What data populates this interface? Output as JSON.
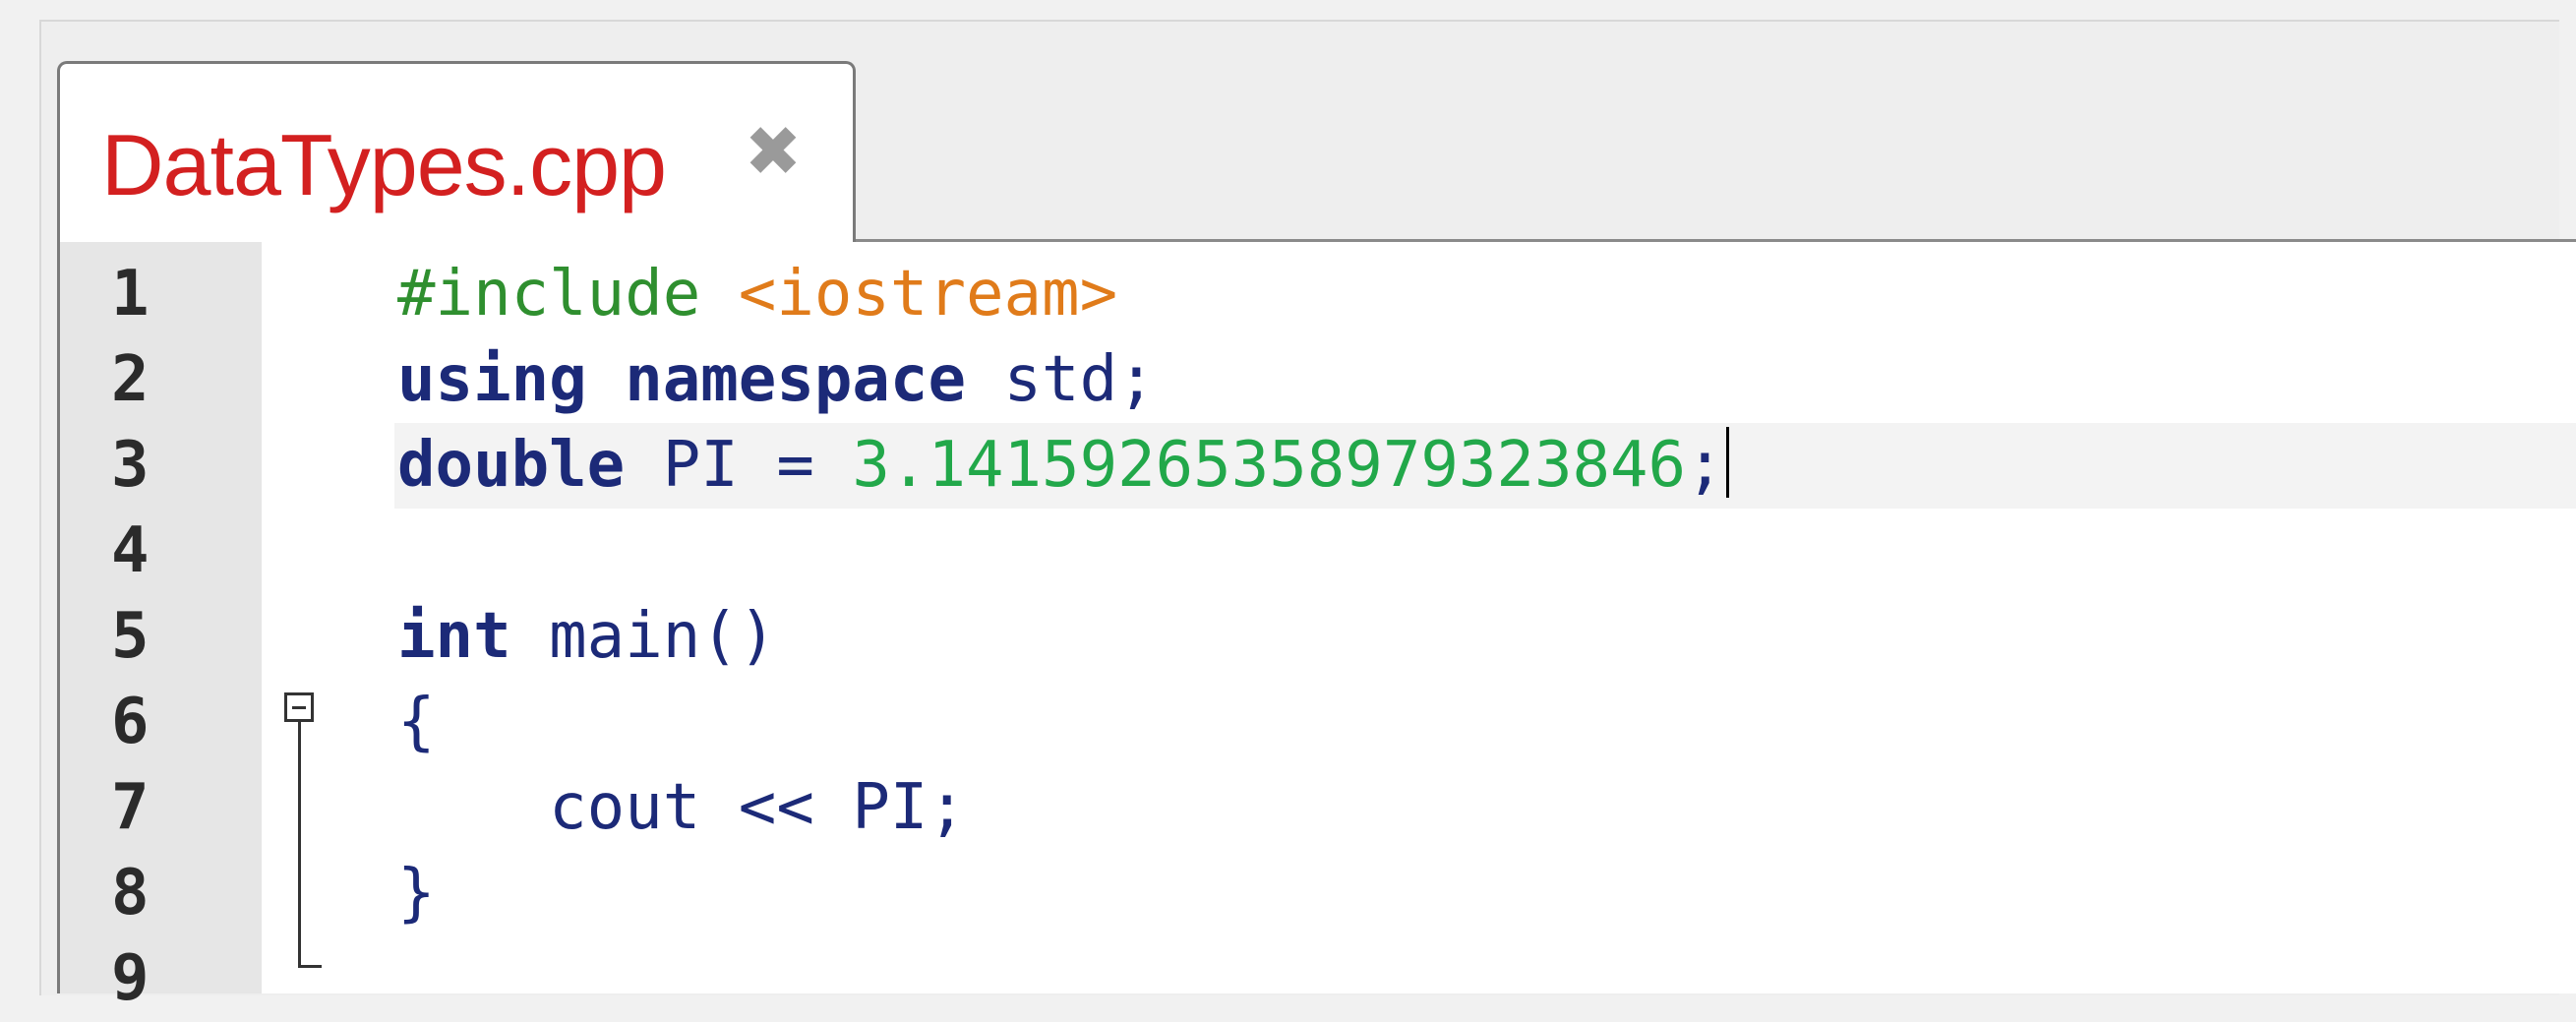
{
  "tab": {
    "title": "DataTypes.cpp",
    "close_glyph": "✖"
  },
  "editor": {
    "line_numbers": [
      "1",
      "2",
      "3",
      "4",
      "5",
      "6",
      "7",
      "8",
      "9"
    ],
    "lines": [
      {
        "n": "1",
        "tokens": [
          {
            "t": "#include",
            "c": "pp"
          },
          {
            "t": " ",
            "c": ""
          },
          {
            "t": "<iostream>",
            "c": "inc"
          }
        ]
      },
      {
        "n": "2",
        "tokens": [
          {
            "t": "using",
            "c": "kw"
          },
          {
            "t": " ",
            "c": ""
          },
          {
            "t": "namespace",
            "c": "kw"
          },
          {
            "t": " std;",
            "c": "id"
          }
        ]
      },
      {
        "n": "3",
        "tokens": [
          {
            "t": "double",
            "c": "kw"
          },
          {
            "t": " PI = ",
            "c": "id"
          },
          {
            "t": "3.14159265358979323846",
            "c": "num"
          },
          {
            "t": ";",
            "c": "id"
          }
        ]
      },
      {
        "n": "4",
        "tokens": []
      },
      {
        "n": "5",
        "tokens": [
          {
            "t": "int",
            "c": "kw"
          },
          {
            "t": " main()",
            "c": "id"
          }
        ]
      },
      {
        "n": "6",
        "tokens": [
          {
            "t": "{",
            "c": "id"
          }
        ]
      },
      {
        "n": "7",
        "tokens": [
          {
            "t": "    cout << PI;",
            "c": "id"
          }
        ]
      },
      {
        "n": "8",
        "tokens": [
          {
            "t": "}",
            "c": "id"
          }
        ]
      },
      {
        "n": "9",
        "tokens": []
      }
    ],
    "cursor_line": "3",
    "colors": {
      "keyword": "#1c2a78",
      "preprocessor": "#2f8f2f",
      "include": "#e07b1a",
      "number": "#22a84a",
      "tab_title": "#d32020"
    }
  }
}
